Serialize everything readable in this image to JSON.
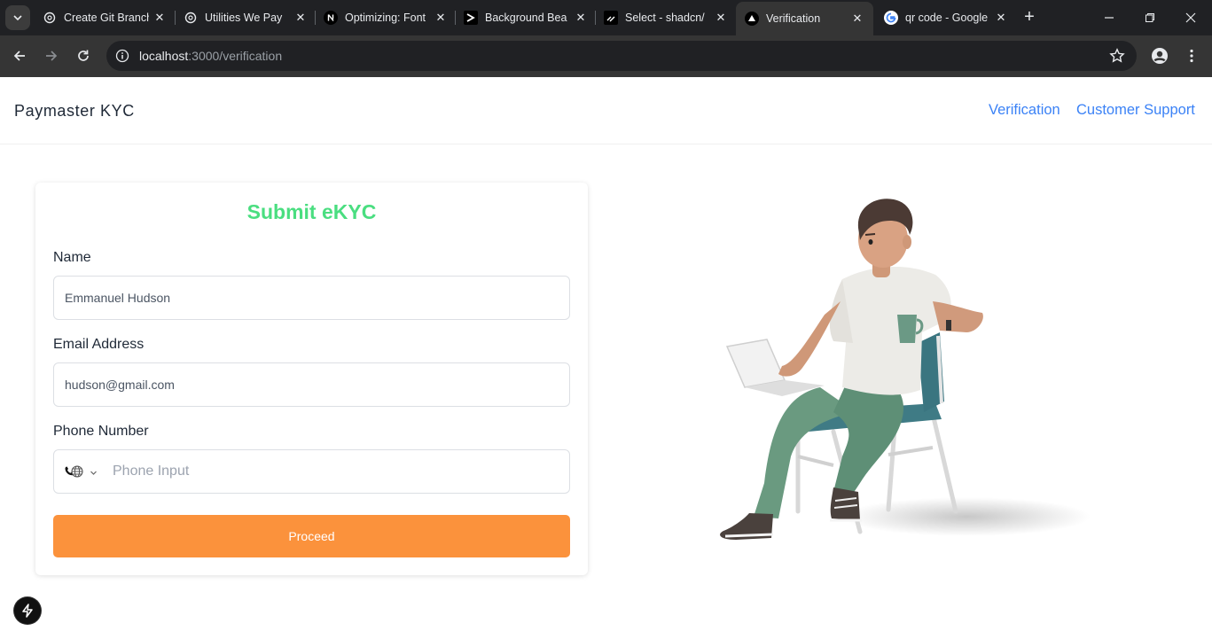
{
  "browser": {
    "tabs": [
      {
        "title": "Create Git Branch",
        "icon": "openai-icon"
      },
      {
        "title": "Utilities We Pay",
        "icon": "openai-icon"
      },
      {
        "title": "Optimizing: Font",
        "icon": "nextjs-icon"
      },
      {
        "title": "Background Bea",
        "icon": "aceternity-icon"
      },
      {
        "title": "Select - shadcn/",
        "icon": "shadcn-icon"
      },
      {
        "title": "Verification",
        "icon": "vercel-triangle-icon"
      },
      {
        "title": "qr code - Google",
        "icon": "google-icon"
      }
    ],
    "active_tab_index": 5,
    "url_host": "localhost",
    "url_rest": ":3000/verification"
  },
  "header": {
    "brand": "Paymaster KYC",
    "nav": {
      "verification": "Verification",
      "support": "Customer Support"
    }
  },
  "form": {
    "title": "Submit eKYC",
    "name_label": "Name",
    "name_value": "Emmanuel Hudson",
    "email_label": "Email Address",
    "email_value": "hudson@gmail.com",
    "phone_label": "Phone Number",
    "phone_placeholder": "Phone Input",
    "submit_label": "Proceed"
  },
  "colors": {
    "title_green": "#4ade80",
    "button_orange": "#fb923c",
    "link_blue": "#3b82f6"
  }
}
